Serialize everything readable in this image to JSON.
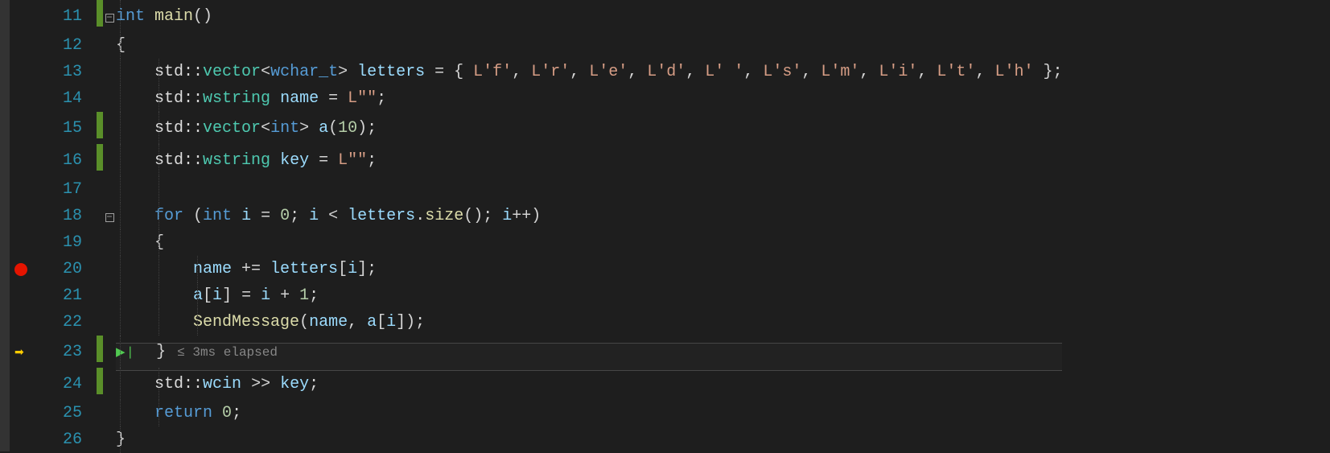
{
  "lines": [
    {
      "num": "11",
      "break": false,
      "arrow": false,
      "changed": true,
      "fold": "minus"
    },
    {
      "num": "12",
      "break": false,
      "arrow": false,
      "changed": false,
      "fold": null
    },
    {
      "num": "13",
      "break": false,
      "arrow": false,
      "changed": false,
      "fold": null
    },
    {
      "num": "14",
      "break": false,
      "arrow": false,
      "changed": false,
      "fold": null
    },
    {
      "num": "15",
      "break": false,
      "arrow": false,
      "changed": true,
      "fold": null
    },
    {
      "num": "16",
      "break": false,
      "arrow": false,
      "changed": true,
      "fold": null
    },
    {
      "num": "17",
      "break": false,
      "arrow": false,
      "changed": false,
      "fold": null
    },
    {
      "num": "18",
      "break": false,
      "arrow": false,
      "changed": false,
      "fold": "minus"
    },
    {
      "num": "19",
      "break": false,
      "arrow": false,
      "changed": false,
      "fold": null
    },
    {
      "num": "20",
      "break": true,
      "arrow": false,
      "changed": false,
      "fold": null
    },
    {
      "num": "21",
      "break": false,
      "arrow": false,
      "changed": false,
      "fold": null
    },
    {
      "num": "22",
      "break": false,
      "arrow": false,
      "changed": false,
      "fold": null
    },
    {
      "num": "23",
      "break": false,
      "arrow": true,
      "changed": true,
      "fold": null
    },
    {
      "num": "24",
      "break": false,
      "arrow": false,
      "changed": true,
      "fold": null
    },
    {
      "num": "25",
      "break": false,
      "arrow": false,
      "changed": false,
      "fold": null
    },
    {
      "num": "26",
      "break": false,
      "arrow": false,
      "changed": false,
      "fold": null
    }
  ],
  "code": {
    "l11": {
      "kw_int": "int",
      "fn_main": "main",
      "parens": "()"
    },
    "l12": {
      "brace": "{"
    },
    "l13": {
      "ns": "std",
      "scope": "::",
      "vec": "vector",
      "lt": "<",
      "wchar": "wchar_t",
      "gt": ">",
      "var": "letters",
      "eq": " = ",
      "open": "{ ",
      "c0": "L'f'",
      "s": ", ",
      "c1": "L'r'",
      "c2": "L'e'",
      "c3": "L'd'",
      "c4": "L' '",
      "c5": "L's'",
      "c6": "L'm'",
      "c7": "L'i'",
      "c8": "L't'",
      "c9": "L'h'",
      "close": " };"
    },
    "l14": {
      "ns": "std",
      "scope": "::",
      "wstr": "wstring",
      "var": "name",
      "eq": " = ",
      "lit": "L\"\"",
      "semi": ";"
    },
    "l15": {
      "ns": "std",
      "scope": "::",
      "vec": "vector",
      "lt": "<",
      "int": "int",
      "gt": ">",
      "var": "a",
      "call": "(",
      "n": "10",
      "end": ");"
    },
    "l16": {
      "ns": "std",
      "scope": "::",
      "wstr": "wstring",
      "var": "key",
      "eq": " = ",
      "lit": "L\"\"",
      "semi": ";"
    },
    "l18": {
      "for": "for",
      "open": " (",
      "int": "int",
      "i": "i",
      "eq": " = ",
      "zero": "0",
      "semi1": "; ",
      "i2": "i",
      "lt": " < ",
      "letters": "letters",
      "dot": ".",
      "size": "size",
      "call": "()",
      "semi2": "; ",
      "i3": "i",
      "inc": "++",
      ")": ")"
    },
    "l19": {
      "brace": "{"
    },
    "l20": {
      "name": "name",
      "op": " += ",
      "letters": "letters",
      "lb": "[",
      "i": "i",
      "rb": "];"
    },
    "l21": {
      "a": "a",
      "lb": "[",
      "i": "i",
      "rb": "]",
      "eq": " = ",
      "i2": "i",
      "plus": " + ",
      "one": "1",
      "semi": ";"
    },
    "l22": {
      "fn": "SendMessage",
      "open": "(",
      "name": "name",
      "comma": ", ",
      "a": "a",
      "lb": "[",
      "i": "i",
      "rb": "]);"
    },
    "l23": {
      "brace": "}",
      "hint": "≤ 3ms elapsed"
    },
    "l24": {
      "ns": "std",
      "scope": "::",
      "wcin": "wcin",
      "op": " >> ",
      "key": "key",
      "semi": ";"
    },
    "l25": {
      "ret": "return",
      "sp": " ",
      "zero": "0",
      "semi": ";"
    },
    "l26": {
      "brace": "}"
    }
  }
}
